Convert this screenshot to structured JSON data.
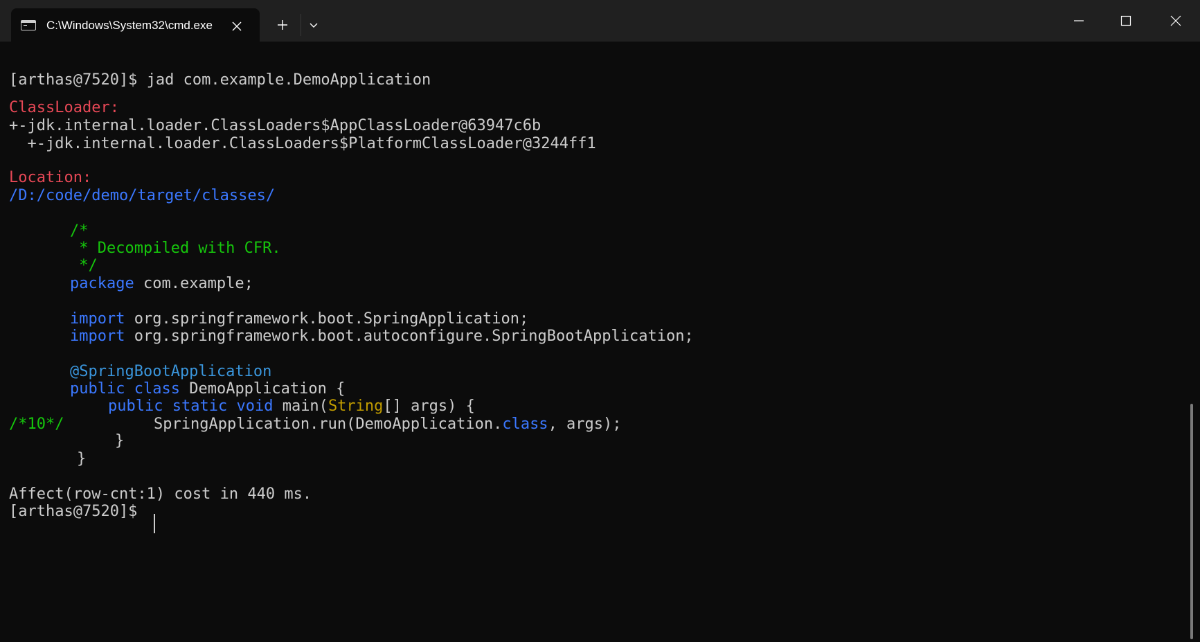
{
  "window": {
    "tab_title": "C:\\Windows\\System32\\cmd.exe",
    "icons": {
      "tab": "terminal-icon",
      "tab_close": "close-icon",
      "new_tab": "plus-icon",
      "dropdown": "chevron-down-icon",
      "minimize": "minimize-icon",
      "maximize": "maximize-icon",
      "close": "close-icon"
    }
  },
  "colors": {
    "background": "#0c0c0c",
    "titlebar": "#202020",
    "text": "#cccccc",
    "red": "#e74856",
    "blue": "#3b78ff",
    "green": "#16c60c",
    "gold": "#c19c00",
    "annotation": "#3a96dd"
  },
  "terminal": {
    "prompt": "[arthas@7520]$",
    "command": "jad com.example.DemoApplication",
    "classloader_label": "ClassLoader:",
    "classloader_line1": "+-jdk.internal.loader.ClassLoaders$AppClassLoader@63947c6b",
    "classloader_line2": "  +-jdk.internal.loader.ClassLoaders$PlatformClassLoader@3244ff1",
    "location_label": "Location:",
    "location_path": "/D:/code/demo/target/classes/",
    "code": {
      "comment_open": "/*",
      "comment_body": " * Decompiled with CFR.",
      "comment_close": " */",
      "kw_package": "package",
      "package_name": " com.example;",
      "kw_import": "import",
      "import1": " org.springframework.boot.SpringApplication;",
      "import2": " org.springframework.boot.autoconfigure.SpringBootApplication;",
      "annotation": "@SpringBootApplication",
      "kw_public": "public",
      "kw_class": "class",
      "class_rest": " DemoApplication {",
      "kw_static": "static",
      "kw_void": "void",
      "main_name": " main(",
      "type_string": "String",
      "main_rest": "[] args) {",
      "line_marker": "/*10*/",
      "run_call": "SpringApplication.run(DemoApplication.",
      "run_rest": ", args);",
      "close_inner": "}",
      "close_outer": "}"
    },
    "result": "Affect(row-cnt:1) cost in 440 ms."
  }
}
